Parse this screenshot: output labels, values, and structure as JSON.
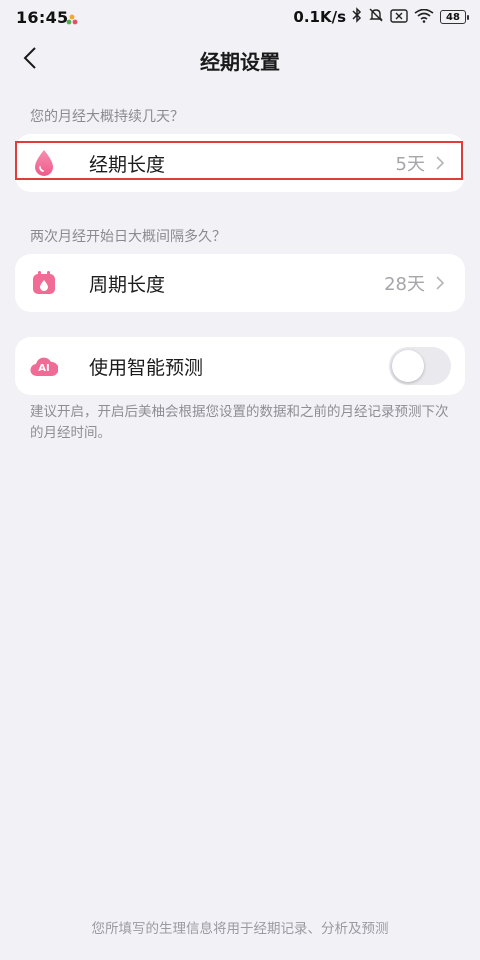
{
  "status_bar": {
    "time": "16:45",
    "net_speed": "0.1K/s",
    "battery_level": "48",
    "icons": [
      "bluetooth-icon",
      "mute-icon",
      "sim-off-icon",
      "wifi-icon",
      "battery-icon"
    ]
  },
  "nav": {
    "title": "经期设置",
    "back_icon": "chevron-left-icon"
  },
  "period_section": {
    "hint": "您的月经大概持续几天？",
    "label": "经期长度",
    "value": "5天",
    "icon": "drop-icon"
  },
  "cycle_section": {
    "hint": "两次月经开始日大概间隔多久？",
    "label": "周期长度",
    "value": "28天",
    "icon": "calendar-icon"
  },
  "smart_predict": {
    "label": "使用智能预测",
    "icon": "ai-cloud-icon",
    "icon_text": "AI",
    "enabled": false,
    "note": "建议开启，开启后美柚会根据您设置的数据和之前的月经记录预测下次的月经时间。"
  },
  "footer": {
    "text": "您所填写的生理信息将用于经期记录、分析及预测"
  },
  "colors": {
    "accent": "#f06b95",
    "background": "#f2f1f6",
    "highlight_border": "#e23b3b"
  }
}
